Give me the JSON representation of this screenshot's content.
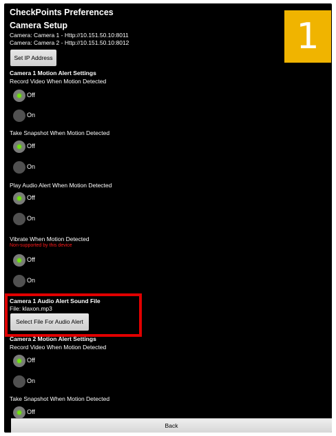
{
  "app": {
    "title": "CheckPoints Preferences"
  },
  "camera_setup": {
    "title": "Camera Setup",
    "cameras": [
      "Camera: Camera 1 - Http://10.151.50.10:8011",
      "Camera: Camera 2 - Http://10.151.50.10:8012"
    ],
    "set_ip_button": "Set IP Address"
  },
  "camera1": {
    "section_title": "Camera 1 Motion Alert Settings",
    "record_label": "Record Video When Motion Detected",
    "snapshot_label": "Take Snapshot When Motion Detected",
    "audio_label": "Play Audio Alert When Motion Detected",
    "vibrate_label": "Vibrate When Motion Detected",
    "vibrate_warning": "Non-supported by this device",
    "off_label": "Off",
    "on_label": "On",
    "record_value": "Off",
    "snapshot_value": "Off",
    "audio_value": "Off",
    "vibrate_value": "Off"
  },
  "camera1_sound": {
    "title": "Camera 1 Audio Alert Sound File",
    "file": "File: klaxon.mp3",
    "select_button": "Select File For Audio Alert"
  },
  "camera2": {
    "section_title": "Camera 2 Motion Alert Settings",
    "record_label": "Record Video When Motion Detected",
    "snapshot_label": "Take Snapshot When Motion Detected",
    "off_label": "Off",
    "on_label": "On",
    "record_value": "Off",
    "snapshot_value": "Off"
  },
  "badge": "1",
  "back_button": "Back",
  "colors": {
    "accent_green": "#6fe30e",
    "badge": "#f0b400",
    "highlight": "#e00000",
    "warning": "#ff1a1a"
  }
}
